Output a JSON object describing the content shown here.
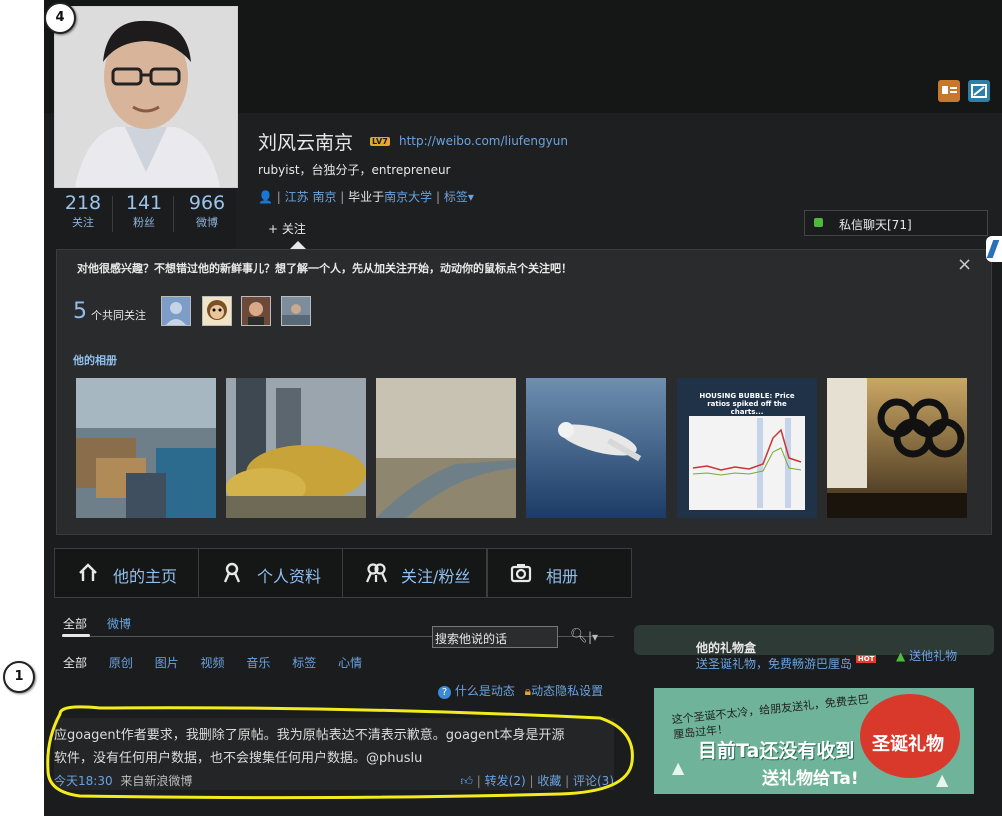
{
  "markers": {
    "top": "4",
    "feed": "1"
  },
  "profile": {
    "name": "刘风云南京",
    "level_badge": "LV7",
    "url": "http://weibo.com/liufengyun",
    "bio": "rubyist，台独分子，entrepreneur",
    "location": "江苏 南京",
    "school": "毕业于南京大学",
    "tags_label": "标签",
    "follow_button": "+ 关注",
    "private_chat": "私信聊天[71]"
  },
  "stats": [
    {
      "num": "218",
      "label": "关注"
    },
    {
      "num": "141",
      "label": "粉丝"
    },
    {
      "num": "966",
      "label": "微博"
    }
  ],
  "intro": {
    "prompt": "对他很感兴趣？不想错过他的新鲜事儿？想了解一个人，先从加关注开始，动动你的鼠标点个关注吧！",
    "common_count": "5",
    "common_label": "个共同关注",
    "album_title": "他的相册",
    "chart_photo_caption": "HOUSING BUBBLE: Price ratios spiked off the charts..."
  },
  "tabs": [
    {
      "label": "他的主页",
      "icon": "home-icon"
    },
    {
      "label": "个人资料",
      "icon": "person-icon"
    },
    {
      "label": "关注/粉丝",
      "icon": "people-icon"
    },
    {
      "label": "相册",
      "icon": "camera-icon"
    }
  ],
  "feed": {
    "top_tabs": [
      "全部",
      "微博"
    ],
    "search_placeholder": "搜索他说的话",
    "filters": [
      "全部",
      "原创",
      "图片",
      "视频",
      "音乐",
      "标签",
      "心情"
    ],
    "what_is_feed": "什么是动态",
    "privacy": "动态隐私设置",
    "post_text_line1": "应goagent作者要求，我删除了原帖。我为原帖表达不清表示歉意。goagent本身是开源",
    "post_text_line2": "软件，没有任何用户数据，也不会搜集任何用户数据。@phuslu",
    "time": "今天18:30",
    "source": "来自新浪微博",
    "repost": "转发(2)",
    "favorite": "收藏",
    "comment": "评论(3)"
  },
  "gift": {
    "title": "他的礼物盒",
    "send_gift": "送他礼物",
    "promo": "送圣诞礼物，免费畅游巴厘岛",
    "hot": "HOT",
    "banner_small": "这个圣诞不太冷，给朋友送礼，免费去巴厘岛过年！",
    "banner_big": "目前Ta还没有收到",
    "banner_red": "圣诞礼物",
    "banner_sub": "送礼物给Ta!"
  }
}
